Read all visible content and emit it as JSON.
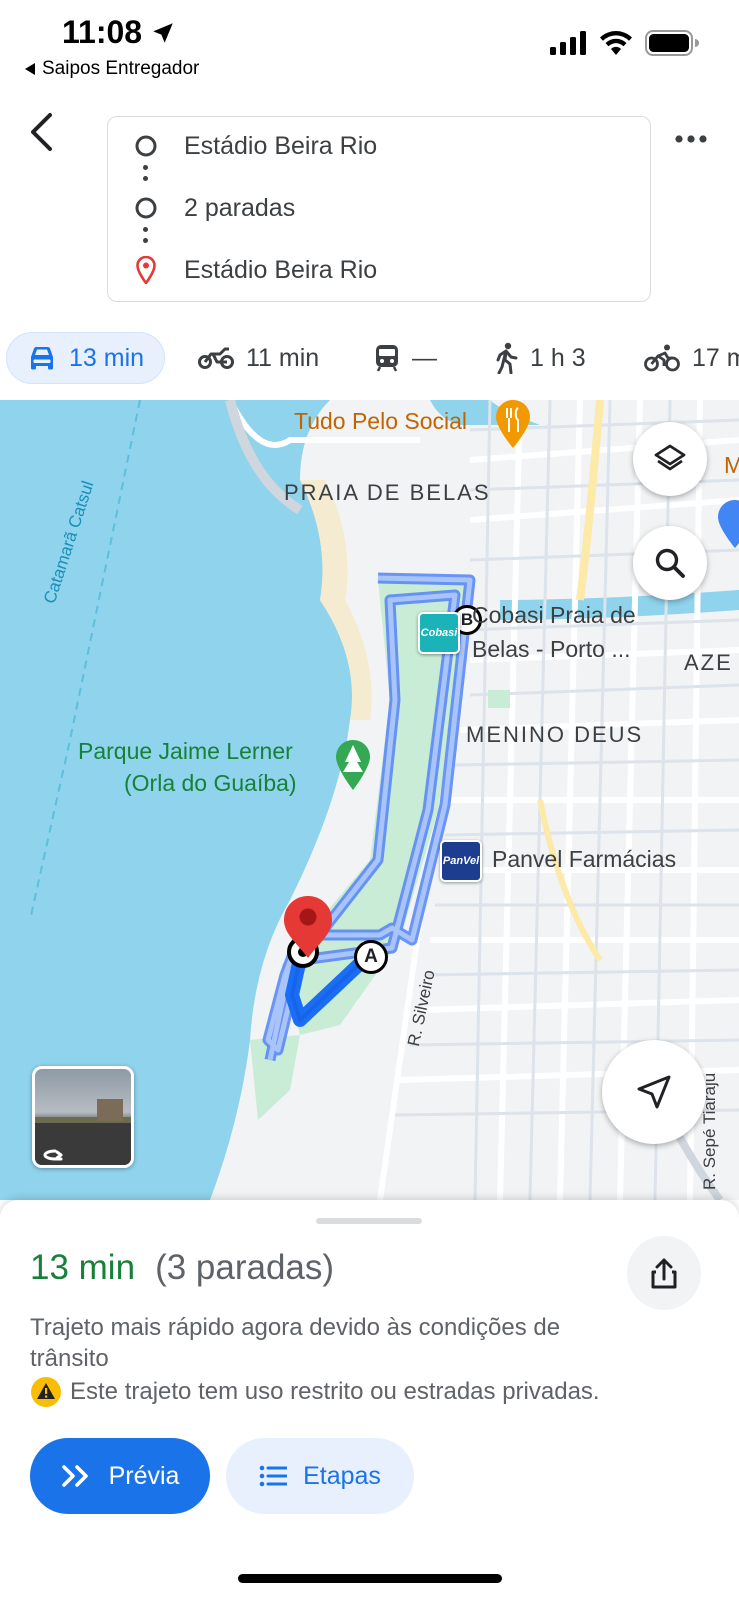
{
  "status_bar": {
    "time": "11:08",
    "back_app_label": "Saipos Entregador"
  },
  "header": {
    "origin": "Estádio Beira Rio",
    "intermediate": "2 paradas",
    "destination": "Estádio Beira Rio"
  },
  "modes": [
    {
      "icon": "car-icon",
      "label": "13 min",
      "selected": true
    },
    {
      "icon": "motorcycle-icon",
      "label": "11 min",
      "selected": false
    },
    {
      "icon": "transit-icon",
      "label": "—",
      "selected": false
    },
    {
      "icon": "walk-icon",
      "label": "1 h 3",
      "selected": false
    },
    {
      "icon": "bike-icon",
      "label": "17 m",
      "selected": false
    }
  ],
  "map": {
    "labels": {
      "tudo_pelo_social": "Tudo Pelo Social",
      "praia_de_belas": "PRAIA DE BELAS",
      "catamara": "Catamarã Catsul",
      "cobasi_line1": "Cobasi Praia de",
      "cobasi_line2": "Belas - Porto ...",
      "azenha_partial": "AZE",
      "menino_deus": "MENINO DEUS",
      "parque_line1": "Parque Jaime Lerner",
      "parque_line2": "(Orla do Guaíba)",
      "panvel": "Panvel Farmácias",
      "r_silveiro": "R. Silveiro",
      "r_sepe": "R. Sepé Tiaraju",
      "partial_m": "M"
    },
    "badges": {
      "cobasi": "Cobasi",
      "panvel": "PanVel"
    },
    "waypoints": {
      "a": "A",
      "b": "B"
    },
    "colors": {
      "water": "#8fd3ec",
      "park": "#c8ecd5",
      "route": "#1a6ef5",
      "route_alt": "#8fb0f5",
      "pin": "#e53935"
    }
  },
  "sheet": {
    "duration": "13 min",
    "stops": "(3 paradas)",
    "description": "Trajeto mais rápido agora devido às condições de trânsito",
    "warning": "Este trajeto tem uso restrito ou estradas privadas.",
    "preview_label": "Prévia",
    "steps_label": "Etapas"
  }
}
